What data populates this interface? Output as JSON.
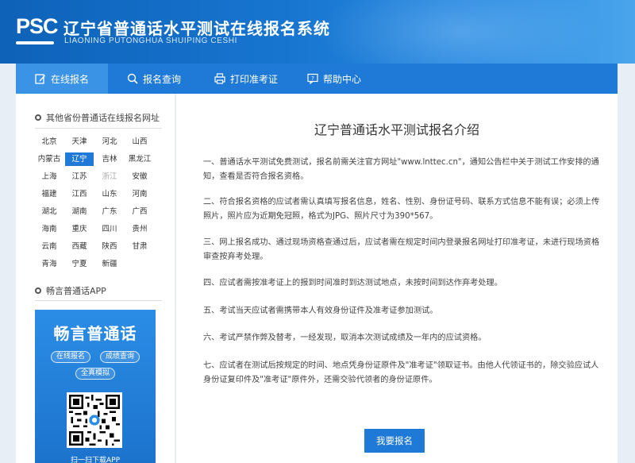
{
  "header": {
    "logo_text": "PSC",
    "title": "辽宁省普通话水平测试在线报名系统",
    "subtitle": "LIAONING PUTONGHUA SHUIPING CESHI"
  },
  "nav": {
    "items": [
      {
        "label": "在线报名",
        "icon": "edit-icon"
      },
      {
        "label": "报名查询",
        "icon": "search-icon"
      },
      {
        "label": "打印准考证",
        "icon": "printer-icon"
      },
      {
        "label": "帮助中心",
        "icon": "help-icon"
      }
    ],
    "active_index": 0
  },
  "sidebar": {
    "provinces_title": "其他省份普通话在线报名网址",
    "provinces": [
      "北京",
      "天津",
      "河北",
      "山西",
      "内蒙古",
      "辽宁",
      "吉林",
      "黑龙江",
      "上海",
      "江苏",
      "浙江",
      "安徽",
      "福建",
      "江西",
      "山东",
      "河南",
      "湖北",
      "湖南",
      "广东",
      "广西",
      "海南",
      "重庆",
      "四川",
      "贵州",
      "云南",
      "西藏",
      "陕西",
      "甘肃",
      "青海",
      "宁夏",
      "新疆"
    ],
    "active_province": "辽宁",
    "dim_province": "浙江",
    "app_title": "畅言普通话APP",
    "app_banner": {
      "name": "畅言普通话",
      "pills": [
        "在线报名",
        "成绩查询",
        "全真模拟"
      ],
      "qr_caption": "扫一扫下载APP"
    }
  },
  "main": {
    "title": "辽宁普通话水平测试报名介绍",
    "paragraphs": [
      "一、普通话水平测试免费测试，报名前需关注官方网址\"www.lnttec.cn\"，通知公告栏中关于测试工作安排的通知，查看是否符合报名资格。",
      "二、符合报名资格的应试者需认真填写报名信息，姓名、性别、身份证号码、联系方式信息不能有误；必须上传照片，照片应为近期免冠照，格式为JPG、照片尺寸为390*567。",
      "三、网上报名成功、通过现场资格查通过后，应试者需在规定时间内登录报名网址打印准考证，未进行现场资格审查按弃考处理。",
      "四、应试者需按准考证上的报到时间准时到达测试地点，未按时间到达作弃考处理。",
      "五、考试当天应试者需携带本人有效身份证件及准考证参加测试。",
      "六、考试严禁作弊及替考，一经发现，取消本次测试成绩及一年内的应试资格。",
      "七、应试者在测试后按规定的时间、地点凭身份证原件及\"准考证\"领取证书。由他人代领证书的，除交验应试人身份证复印件及\"准考证\"原件外，还需交验代领者的身份证原件。"
    ],
    "register_button": "我要报名"
  },
  "colors": {
    "primary": "#1f79d6",
    "header_start": "#0e62b8",
    "header_end": "#4aa5ec"
  }
}
